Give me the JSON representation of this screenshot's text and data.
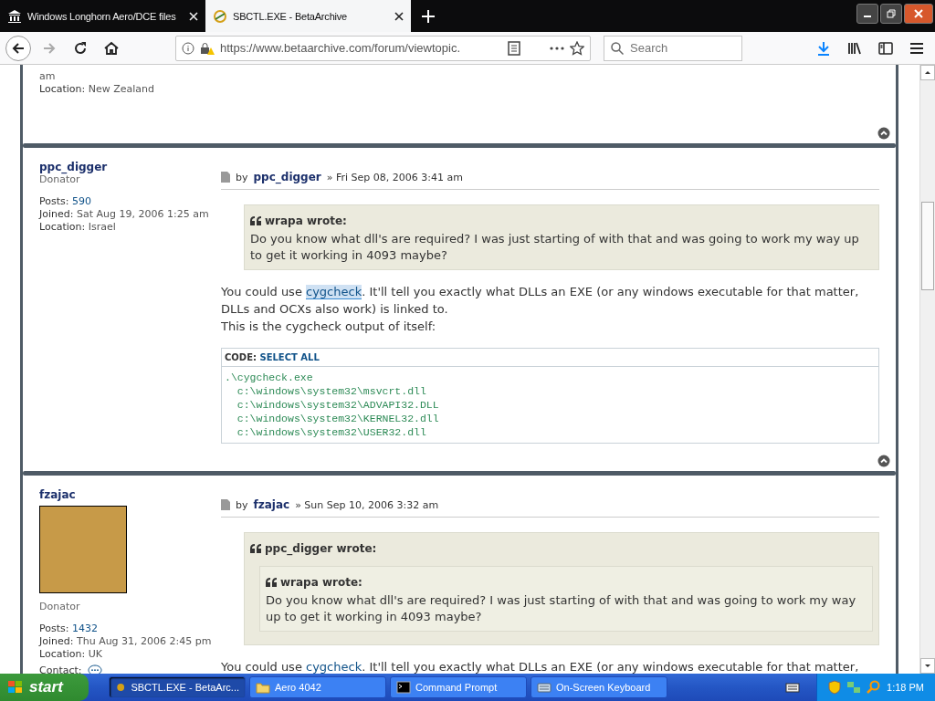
{
  "browser": {
    "tabs": [
      {
        "title": "Windows Longhorn Aero/DCE files",
        "selected": false
      },
      {
        "title": "SBCTL.EXE - BetaArchive",
        "selected": true
      }
    ],
    "url": "https://www.betaarchive.com/forum/viewtopic.",
    "search": {
      "placeholder": "Search"
    }
  },
  "top_post": {
    "lines": [
      "am"
    ],
    "location_label": "Location:",
    "location": "New Zealand"
  },
  "posts": [
    {
      "author": "ppc_digger",
      "rank": "Donator",
      "avatar": false,
      "profile": [
        {
          "label": "Posts:",
          "value": "590",
          "kind": "link"
        },
        {
          "label": "Joined:",
          "value": "Sat Aug 19, 2006 1:25 am",
          "kind": "text"
        },
        {
          "label": "Location:",
          "value": "Israel",
          "kind": "text"
        }
      ],
      "by": "by",
      "byline_author": "ppc_digger",
      "date": "» Fri Sep 08, 2006 3:41 am",
      "quote": {
        "author": "wrapa wrote:",
        "text": "Do you know what dll's are required? I was just starting of with that and was going to work my way up to get it working in 4093 maybe?"
      },
      "body": [
        {
          "before": "You could use ",
          "link": "cygcheck",
          "link_selected": true,
          "after": ". It'll tell you exactly what DLLs an EXE (or any windows executable for that matter, DLLs and OCXs also work) is linked to."
        },
        {
          "before": "This is the cygcheck output of itself:"
        }
      ],
      "code": {
        "label": "CODE:",
        "action": "SELECT ALL",
        "lines": [
          ".\\cygcheck.exe",
          "  c:\\windows\\system32\\msvcrt.dll",
          "  c:\\windows\\system32\\ADVAPI32.DLL",
          "  c:\\windows\\system32\\KERNEL32.dll",
          "  c:\\windows\\system32\\USER32.dll"
        ]
      }
    },
    {
      "author": "fzajac",
      "rank": "Donator",
      "avatar": true,
      "profile": [
        {
          "label": "Posts:",
          "value": "1432",
          "kind": "link"
        },
        {
          "label": "Joined:",
          "value": "Thu Aug 31, 2006 2:45 pm",
          "kind": "text"
        },
        {
          "label": "Location:",
          "value": "UK",
          "kind": "text"
        }
      ],
      "contact_label": "Contact:",
      "by": "by",
      "byline_author": "fzajac",
      "date": "» Sun Sep 10, 2006 3:32 am",
      "quote": {
        "author": "ppc_digger wrote:",
        "nested": {
          "author": "wrapa wrote:",
          "text": "Do you know what dll's are required? I was just starting of with that and was going to work my way up to get it working in 4093 maybe?"
        }
      },
      "body": [
        {
          "before": "You could use ",
          "link": "cygcheck",
          "link_selected": false,
          "after": ". It'll tell you exactly what DLLs an EXE (or any windows executable for that matter,"
        }
      ]
    }
  ],
  "taskbar": {
    "start": "start",
    "items": [
      {
        "label": "SBCTL.EXE - BetaArc...",
        "selected": true
      },
      {
        "label": "Aero 4042",
        "selected": false
      },
      {
        "label": "Command Prompt",
        "selected": false
      },
      {
        "label": "On-Screen Keyboard",
        "selected": false
      }
    ],
    "clock": "1:18 PM"
  }
}
